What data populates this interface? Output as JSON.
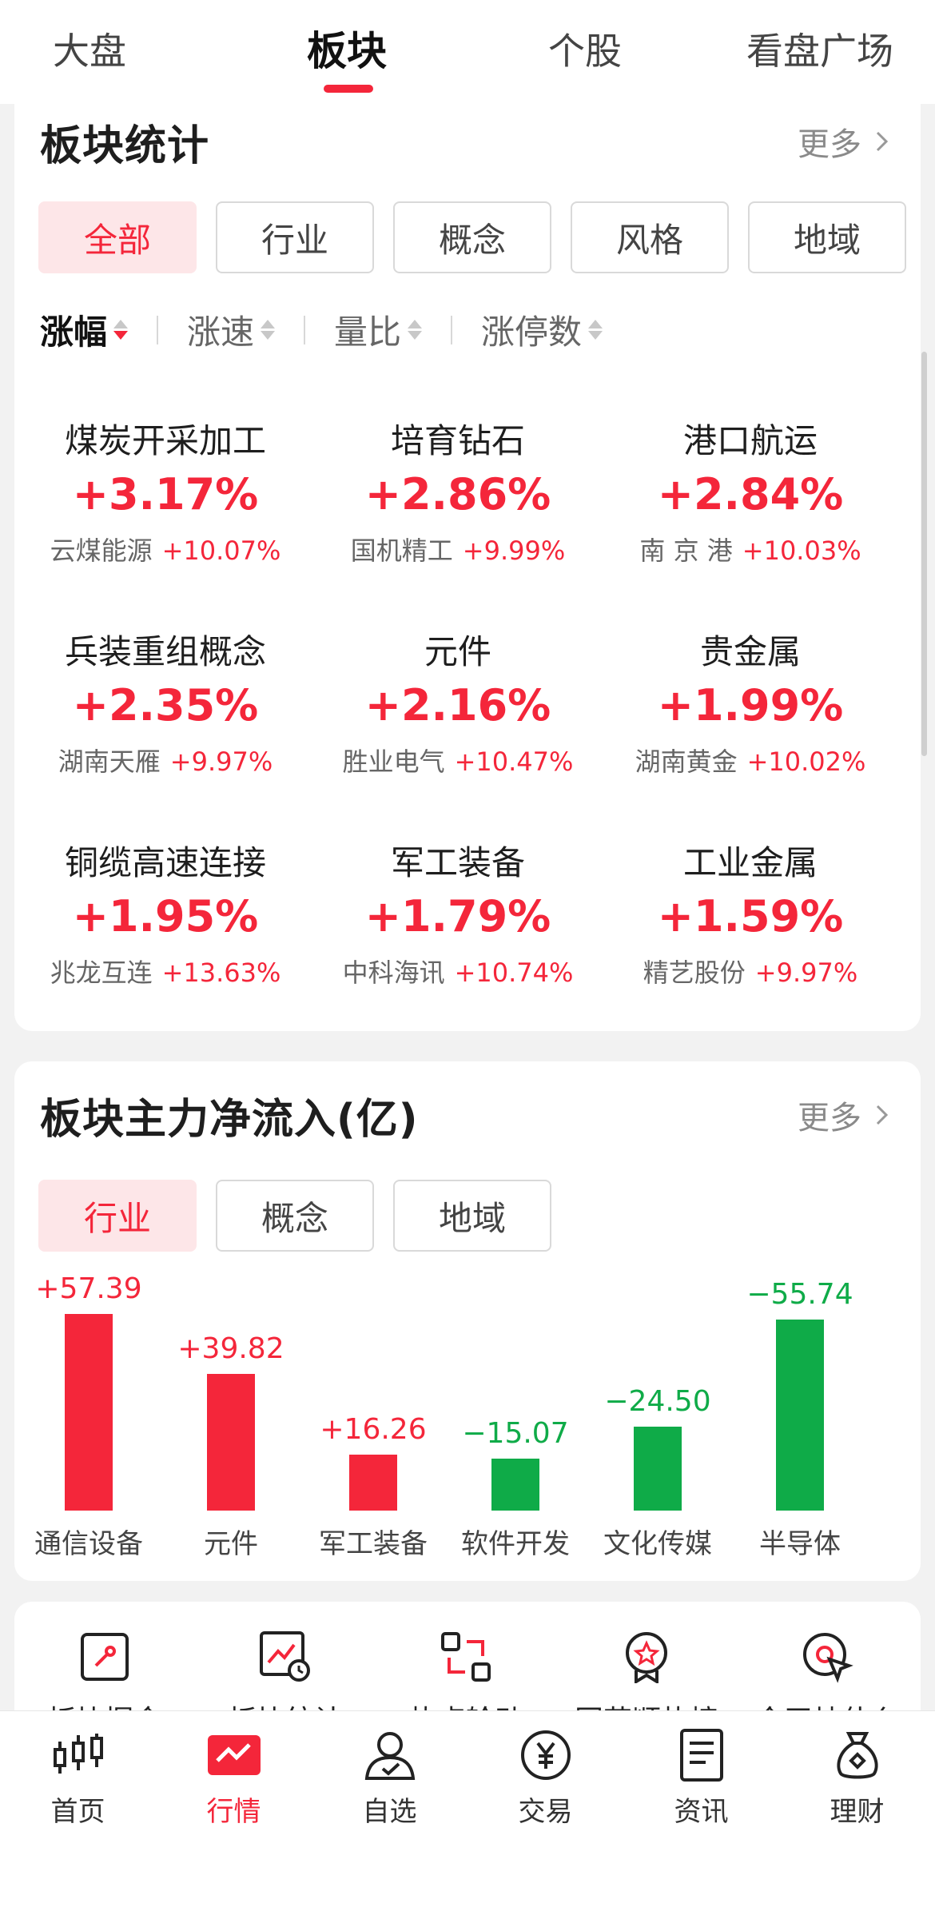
{
  "top_tabs": [
    "大盘",
    "板块",
    "个股",
    "看盘广场"
  ],
  "section1": {
    "title": "板块统计",
    "more": "更多",
    "chips": [
      "全部",
      "行业",
      "概念",
      "风格",
      "地域"
    ],
    "sorts": [
      "涨幅",
      "涨速",
      "量比",
      "涨停数"
    ],
    "sectors": [
      {
        "name": "煤炭开采加工",
        "pct": "+3.17%",
        "stock": "云煤能源",
        "stock_pct": "+10.07%"
      },
      {
        "name": "培育钻石",
        "pct": "+2.86%",
        "stock": "国机精工",
        "stock_pct": "+9.99%"
      },
      {
        "name": "港口航运",
        "pct": "+2.84%",
        "stock": "南 京 港",
        "stock_pct": "+10.03%"
      },
      {
        "name": "兵装重组概念",
        "pct": "+2.35%",
        "stock": "湖南天雁",
        "stock_pct": "+9.97%"
      },
      {
        "name": "元件",
        "pct": "+2.16%",
        "stock": "胜业电气",
        "stock_pct": "+10.47%"
      },
      {
        "name": "贵金属",
        "pct": "+1.99%",
        "stock": "湖南黄金",
        "stock_pct": "+10.02%"
      },
      {
        "name": "铜缆高速连接",
        "pct": "+1.95%",
        "stock": "兆龙互连",
        "stock_pct": "+13.63%"
      },
      {
        "name": "军工装备",
        "pct": "+1.79%",
        "stock": "中科海讯",
        "stock_pct": "+10.74%"
      },
      {
        "name": "工业金属",
        "pct": "+1.59%",
        "stock": "精艺股份",
        "stock_pct": "+9.97%"
      }
    ]
  },
  "section2": {
    "title": "板块主力净流入(亿)",
    "more": "更多",
    "chips": [
      "行业",
      "概念",
      "地域"
    ]
  },
  "chart_data": {
    "type": "bar",
    "categories": [
      "通信设备",
      "元件",
      "军工装备",
      "软件开发",
      "文化传媒",
      "半导体"
    ],
    "values": [
      57.39,
      39.82,
      16.26,
      -15.07,
      -24.5,
      -55.74
    ],
    "value_labels": [
      "+57.39",
      "+39.82",
      "+16.26",
      "−15.07",
      "−24.50",
      "−55.74"
    ],
    "colors": {
      "positive": "#f4263a",
      "negative": "#0fab48"
    }
  },
  "tools": [
    "板块掘金",
    "板块统计",
    "热点轮动",
    "同花顺热榜",
    "今天炒什么"
  ],
  "bottom_nav": [
    "首页",
    "行情",
    "自选",
    "交易",
    "资讯",
    "理财"
  ],
  "colors": {
    "accent": "#f4263a",
    "up": "#f4263a",
    "down": "#0fab48"
  }
}
